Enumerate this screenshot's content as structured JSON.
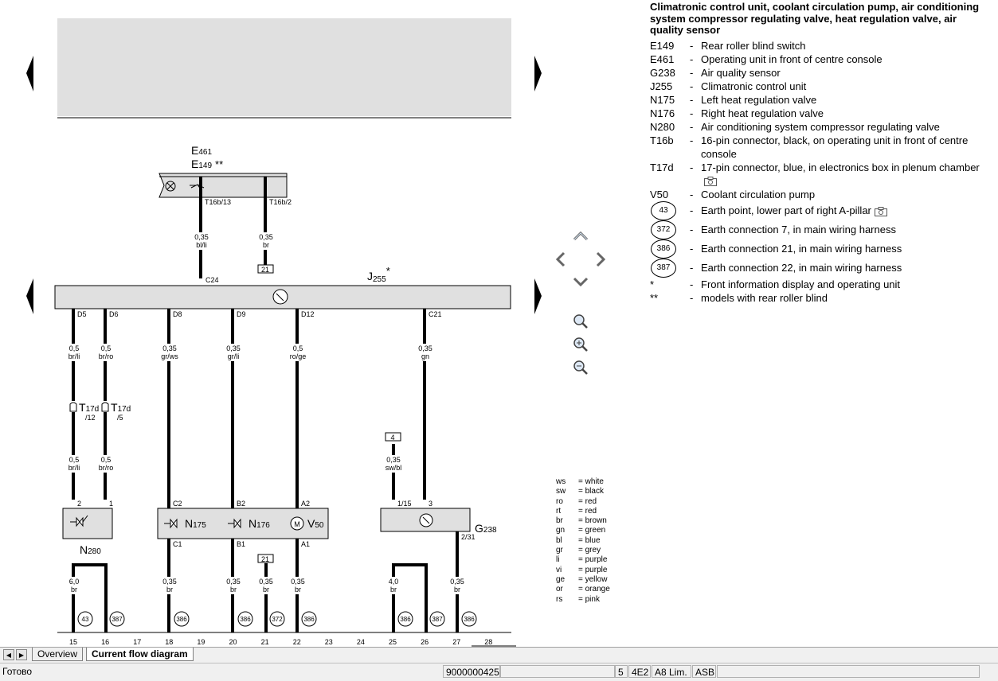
{
  "legend": {
    "title": "Climatronic control unit, coolant circulation pump, air conditioning system compressor regulating valve, heat regulation valve, air quality sensor",
    "items": [
      {
        "code": "E149",
        "desc": "Rear roller blind switch"
      },
      {
        "code": "E461",
        "desc": "Operating unit in front of centre console"
      },
      {
        "code": "G238",
        "desc": "Air quality sensor"
      },
      {
        "code": "J255",
        "desc": "Climatronic control unit"
      },
      {
        "code": "N175",
        "desc": "Left heat regulation valve"
      },
      {
        "code": "N176",
        "desc": "Right heat regulation valve"
      },
      {
        "code": "N280",
        "desc": "Air conditioning system compressor regulating valve"
      },
      {
        "code": "T16b",
        "desc": "16-pin connector, black, on operating unit in front of centre console"
      },
      {
        "code": "T17d",
        "desc": "17-pin connector, blue, in electronics box in plenum chamber"
      },
      {
        "code": "V50",
        "desc": "Coolant circulation pump"
      }
    ],
    "earth_items": [
      {
        "code": "43",
        "desc": "Earth point, lower part of right A-pillar"
      },
      {
        "code": "372",
        "desc": "Earth connection 7, in main wiring harness"
      },
      {
        "code": "386",
        "desc": "Earth connection 21, in main wiring harness"
      },
      {
        "code": "387",
        "desc": "Earth connection 22, in main wiring harness"
      }
    ],
    "notes": [
      {
        "code": "*",
        "desc": "Front information display and operating unit"
      },
      {
        "code": "**",
        "desc": "models with rear roller blind"
      }
    ]
  },
  "colors": [
    {
      "code": "ws",
      "name": "white"
    },
    {
      "code": "sw",
      "name": "black"
    },
    {
      "code": "ro",
      "name": "red"
    },
    {
      "code": "rt",
      "name": "red"
    },
    {
      "code": "br",
      "name": "brown"
    },
    {
      "code": "gn",
      "name": "green"
    },
    {
      "code": "bl",
      "name": "blue"
    },
    {
      "code": "gr",
      "name": "grey"
    },
    {
      "code": "li",
      "name": "purple"
    },
    {
      "code": "vi",
      "name": "purple"
    },
    {
      "code": "ge",
      "name": "yellow"
    },
    {
      "code": "or",
      "name": "orange"
    },
    {
      "code": "rs",
      "name": "pink"
    }
  ],
  "diagram": {
    "e461": "E",
    "e461_sub": "461",
    "e149": "E",
    "e149_sub": "149",
    "e149_mark": "**",
    "j255": "J",
    "j255_sub": "255",
    "j255_mark": "*",
    "n280": "N",
    "n280_sub": "280",
    "n175": "N",
    "n175_sub": "175",
    "n176": "N",
    "n176_sub": "176",
    "v50": "V",
    "v50_sub": "50",
    "g238": "G",
    "g238_sub": "238",
    "t16b13": "T16b/13",
    "t16b2": "T16b/2",
    "c24": "C24",
    "top_w1_size": "0,35",
    "top_w1_color": "bl/li",
    "top_w2_size": "0,35",
    "top_w2_color": "br",
    "box21_top": "21",
    "pins_top": [
      "D5",
      "D6",
      "D8",
      "D9",
      "D12",
      "C21"
    ],
    "wires_upper": [
      {
        "size": "0,5",
        "color": "br/li"
      },
      {
        "size": "0,5",
        "color": "br/ro"
      },
      {
        "size": "0,35",
        "color": "gr/ws"
      },
      {
        "size": "0,35",
        "color": "gr/li"
      },
      {
        "size": "0,5",
        "color": "ro/ge"
      },
      {
        "size": "0,35",
        "color": "gn"
      }
    ],
    "t17d_a": "T",
    "t17d_a_sub": "17d",
    "t17d_a_pin": "/12",
    "t17d_b": "T",
    "t17d_b_sub": "17d",
    "t17d_b_pin": "/5",
    "wires_mid": [
      {
        "size": "0,5",
        "color": "br/li"
      },
      {
        "size": "0,5",
        "color": "br/ro"
      }
    ],
    "box4": "4",
    "g238_wire_size": "0,35",
    "g238_wire_color": "sw/bl",
    "comp_pins_top": [
      "2",
      "1",
      "C2",
      "B2",
      "A2",
      "1/15",
      "3"
    ],
    "comp_pins_bottom": [
      "C1",
      "B1",
      "A1",
      "2/31"
    ],
    "box21_bottom": "21",
    "wires_lower": [
      {
        "size": "6,0",
        "color": "br"
      },
      {
        "size": "0,35",
        "color": "br"
      },
      {
        "size": "0,35",
        "color": "br"
      },
      {
        "size": "0,35",
        "color": "br"
      },
      {
        "size": "0,35",
        "color": "br"
      },
      {
        "size": "4,0",
        "color": "br"
      },
      {
        "size": "0,35",
        "color": "br"
      }
    ],
    "earths": [
      "43",
      "387",
      "386",
      "386",
      "372",
      "386",
      "386",
      "387",
      "386"
    ],
    "tracks": [
      "15",
      "16",
      "17",
      "18",
      "19",
      "20",
      "21",
      "22",
      "23",
      "24",
      "25",
      "26",
      "27",
      "28"
    ]
  },
  "tabs": {
    "overview": "Overview",
    "current": "Current flow diagram"
  },
  "status": {
    "left": "Готово",
    "doc_number": "9000000425",
    "page": "5",
    "model_code": "4E2",
    "model": "A8 Lim.",
    "engine": "ASB"
  }
}
